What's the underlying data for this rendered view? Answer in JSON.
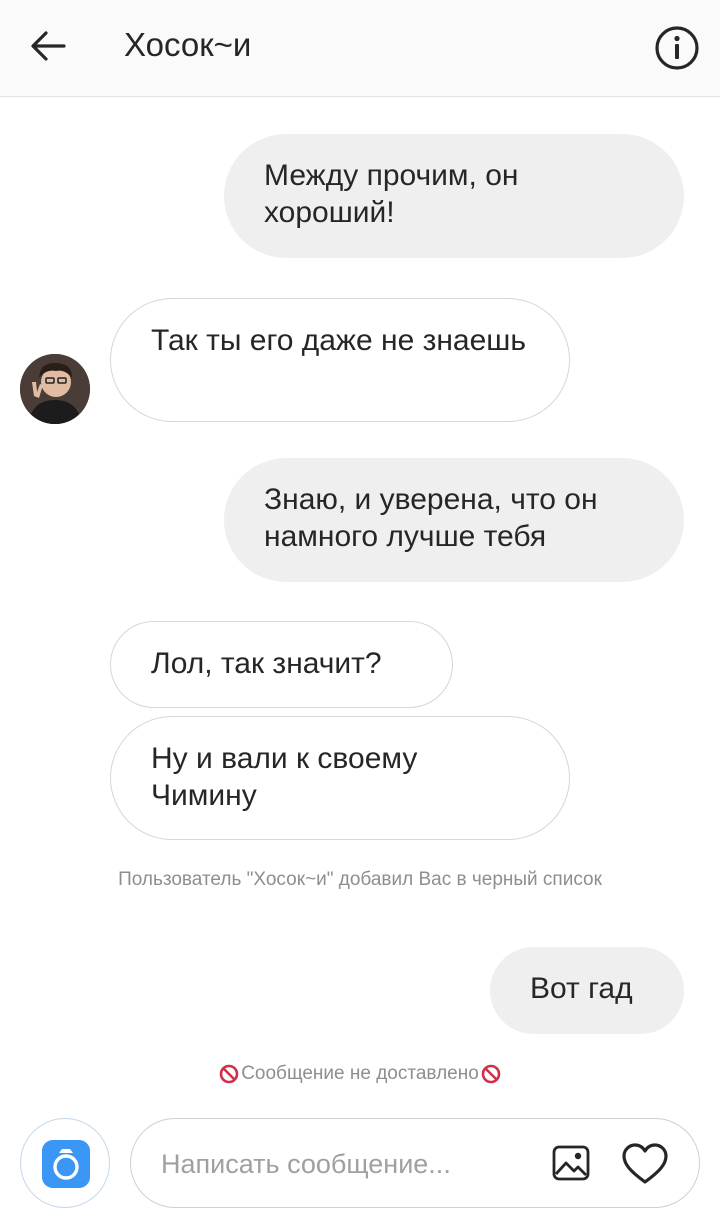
{
  "header": {
    "title": "Хосок~и",
    "back_icon": "arrow-left-icon",
    "info_icon": "info-circle-icon"
  },
  "messages": [
    {
      "side": "out",
      "text": "Между прочим, он хороший!"
    },
    {
      "side": "in",
      "text": "Так ты его даже не знаешь"
    },
    {
      "side": "out",
      "text": "Знаю, и уверена, что он намного лучше тебя"
    },
    {
      "side": "in",
      "text": "Лол, так значит?"
    },
    {
      "side": "in",
      "text": "Ну и вали к своему Чимину"
    },
    {
      "side": "out",
      "text": "Вот гад"
    }
  ],
  "system": {
    "blocked_notice": "Пользователь \"Хосок~и\" добавил Вас в черный список",
    "not_delivered": "Сообщение не доставлено",
    "not_delivered_icon": "prohibited-icon"
  },
  "composer": {
    "placeholder": "Написать сообщение...",
    "camera_icon": "camera-icon",
    "gallery_icon": "image-icon",
    "like_icon": "heart-icon"
  },
  "colors": {
    "accent_blue": "#3a97f5",
    "outgoing_bubble": "#efefef",
    "prohibited_red": "#d0304a"
  }
}
